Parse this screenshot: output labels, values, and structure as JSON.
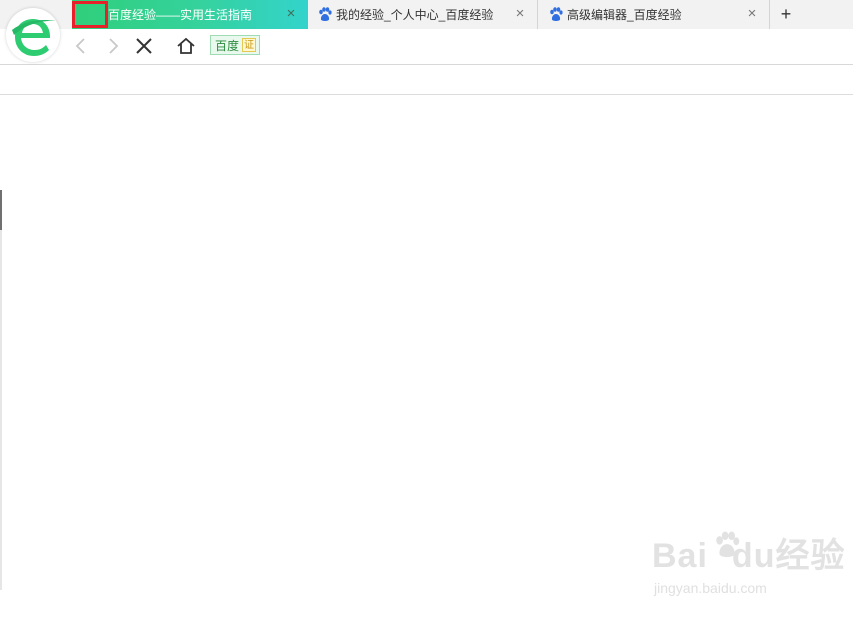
{
  "browser": {
    "logo_icon": "green-e-browser-logo",
    "accent_color": "#2fcf7a",
    "highlight_color": "#e8202a"
  },
  "tabs": [
    {
      "label": "百度经验——实用生活指南",
      "active": true
    },
    {
      "label": "我的经验_个人中心_百度经验",
      "active": false
    },
    {
      "label": "高级编辑器_百度经验",
      "active": false
    }
  ],
  "new_tab_label": "+",
  "tab_close_label": "×",
  "toolbar": {
    "back_icon": "chevron-left-icon",
    "forward_icon": "chevron-right-icon",
    "stop_icon": "close-icon",
    "home_icon": "home-icon",
    "cert_site": "百度",
    "cert_badge": "证"
  },
  "watermark": {
    "main_left": "Bai",
    "main_mid": "du",
    "main_right": "经验",
    "sub": "jingyan.baidu.com"
  }
}
